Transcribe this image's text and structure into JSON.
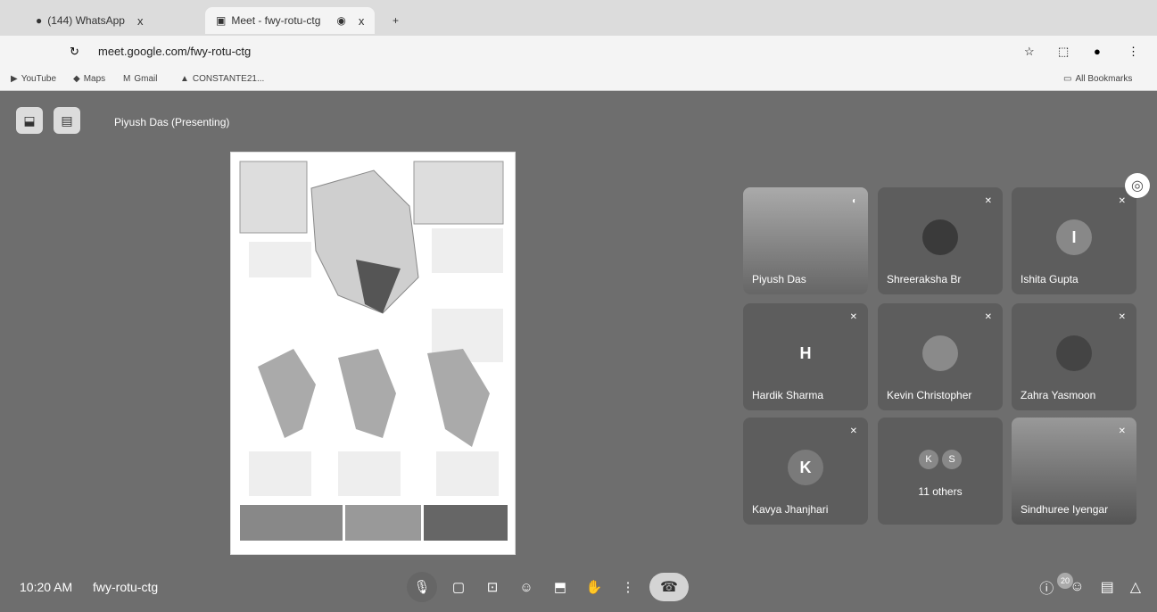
{
  "browser": {
    "tab1": {
      "title": "(144) WhatsApp",
      "close": "x"
    },
    "tab2": {
      "title": "Meet - fwy-rotu-ctg",
      "close": "x"
    },
    "new_tab": "+",
    "url": "meet.google.com/fwy-rotu-ctg",
    "bookmarks": [
      {
        "label": "YouTube"
      },
      {
        "label": "Maps"
      },
      {
        "label": "Gmail"
      },
      {
        "label": "CONSTANTE21..."
      }
    ],
    "all_bookmarks": "All Bookmarks"
  },
  "meeting": {
    "presenter_label": "Piyush Das (Presenting)",
    "participants": [
      {
        "name": "Piyush Das",
        "type": "video"
      },
      {
        "name": "Shreeraksha Br",
        "type": "avatar",
        "initial": ""
      },
      {
        "name": "Ishita Gupta",
        "type": "avatar",
        "initial": "I"
      },
      {
        "name": "Hardik Sharma",
        "type": "avatar",
        "initial": "H"
      },
      {
        "name": "Kevin Christopher",
        "type": "avatar",
        "initial": ""
      },
      {
        "name": "Zahra Yasmoon",
        "type": "avatar",
        "initial": ""
      },
      {
        "name": "Kavya Jhanjhari",
        "type": "avatar",
        "initial": "K"
      },
      {
        "name": "11 others",
        "type": "others",
        "initial": ""
      },
      {
        "name": "Sindhuree Iyengar",
        "type": "video"
      }
    ],
    "others_initials": [
      "K",
      "S"
    ],
    "time": "10:20 AM",
    "code": "fwy-rotu-ctg",
    "participant_count": "20"
  }
}
